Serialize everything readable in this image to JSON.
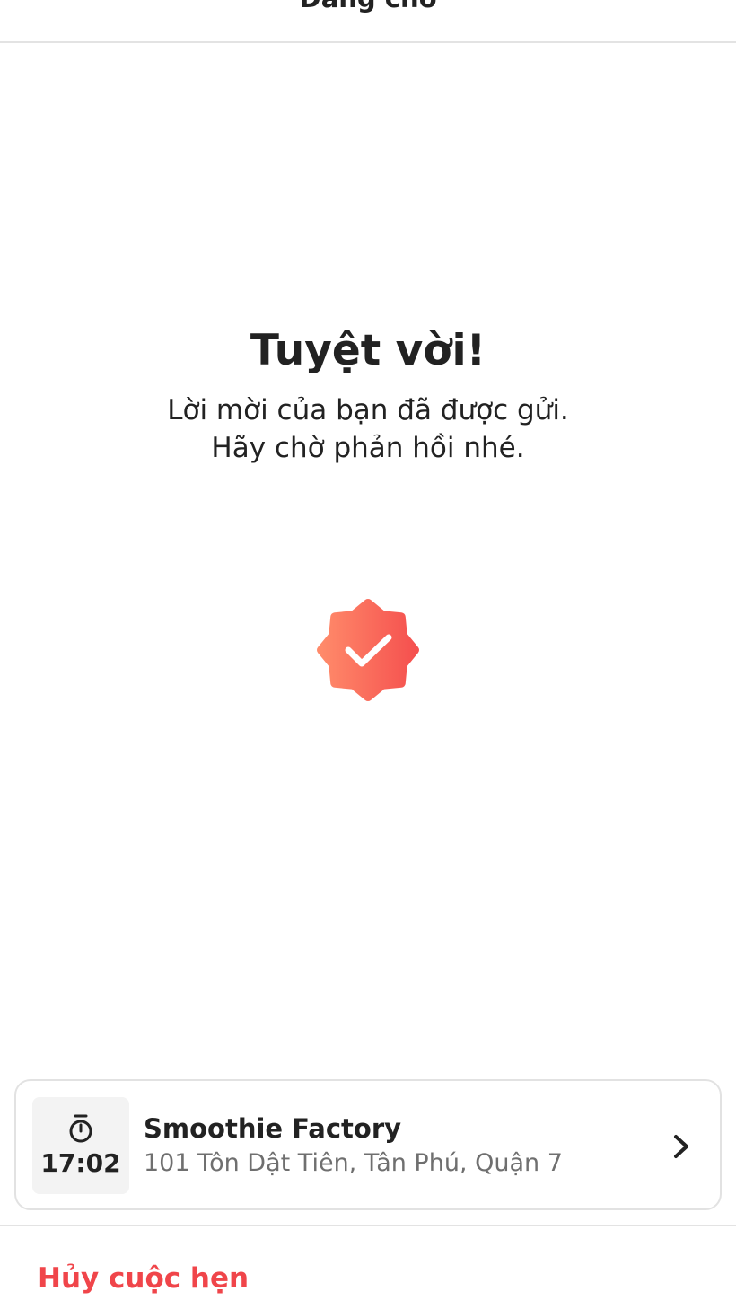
{
  "header": {
    "title": "Đang chờ"
  },
  "main": {
    "headline": "Tuyệt vời!",
    "message_line1": "Lời mời của bạn đã được gửi.",
    "message_line2": "Hãy chờ phản hồi nhé.",
    "status_icon": "verified-badge-check-icon"
  },
  "appointment": {
    "time": "17:02",
    "time_icon": "stopwatch-icon",
    "venue_name": "Smoothie Factory",
    "venue_address": "101 Tôn Dật Tiên, Tân Phú, Quận 7",
    "chevron_icon": "chevron-right-icon"
  },
  "footer": {
    "cancel_label": "Hủy cuộc hẹn"
  },
  "colors": {
    "accent_start": "#ff8a6a",
    "accent_end": "#f5514f",
    "cancel_text": "#f0454a"
  }
}
